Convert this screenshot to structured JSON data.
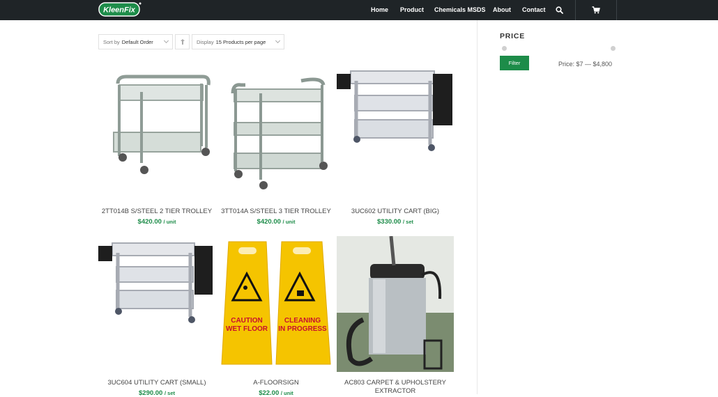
{
  "header": {
    "logo_text": "KleenFix",
    "nav": [
      "Home",
      "Product",
      "Chemicals MSDS",
      "About",
      "Contact"
    ]
  },
  "toolbar": {
    "sort_prefix": "Sort by",
    "sort_value": "Default Order",
    "display_prefix": "Display",
    "display_value": "15 Products per page"
  },
  "products": [
    {
      "name": "2TT014B S/STEEL 2 TIER TROLLEY",
      "price": "$420.00",
      "unit": "/ unit"
    },
    {
      "name": "3TT014A S/STEEL 3 TIER TROLLEY",
      "price": "$420.00",
      "unit": "/ unit"
    },
    {
      "name": "3UC602 UTILITY CART (BIG)",
      "price": "$330.00",
      "unit": "/ set"
    },
    {
      "name": "3UC604 UTILITY CART (SMALL)",
      "price": "$290.00",
      "unit": "/ set"
    },
    {
      "name": "A-FLOORSIGN",
      "price": "$22.00",
      "unit": "/ unit"
    },
    {
      "name": "AC803 CARPET & UPHOLSTERY EXTRACTOR",
      "price": "",
      "unit": ""
    }
  ],
  "sign": {
    "left": [
      "CAUTION",
      "WET FLOOR"
    ],
    "right": [
      "CLEANING",
      "IN PROGRESS"
    ]
  },
  "sidebar": {
    "title": "PRICE",
    "filter_label": "Filter",
    "range": "Price: $7 — $4,800"
  },
  "colors": {
    "accent": "#1d8c49",
    "topbar": "#1f2427"
  }
}
